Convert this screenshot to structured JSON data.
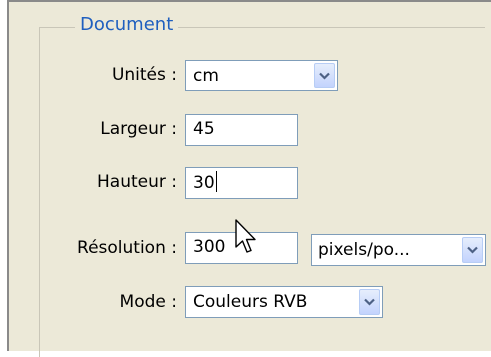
{
  "group": {
    "title": "Document"
  },
  "fields": {
    "unites": {
      "label": "Unités :",
      "value": "cm",
      "arrow_icon": "chevron-down-icon"
    },
    "largeur": {
      "label": "Largeur :",
      "value": "45"
    },
    "hauteur": {
      "label": "Hauteur :",
      "value": "30"
    },
    "resolution": {
      "label": "Résolution :",
      "value": "300",
      "unit_value": "pixels/po...",
      "arrow_icon": "chevron-down-icon"
    },
    "mode": {
      "label": "Mode :",
      "value": "Couleurs RVB",
      "arrow_icon": "chevron-down-icon"
    }
  },
  "colors": {
    "panel_bg": "#ece9d8",
    "title": "#1f5fbf",
    "field_border": "#7f9db9",
    "arrow_glyph": "#4d6185"
  },
  "cursor": {
    "icon": "arrow-pointer-icon"
  }
}
